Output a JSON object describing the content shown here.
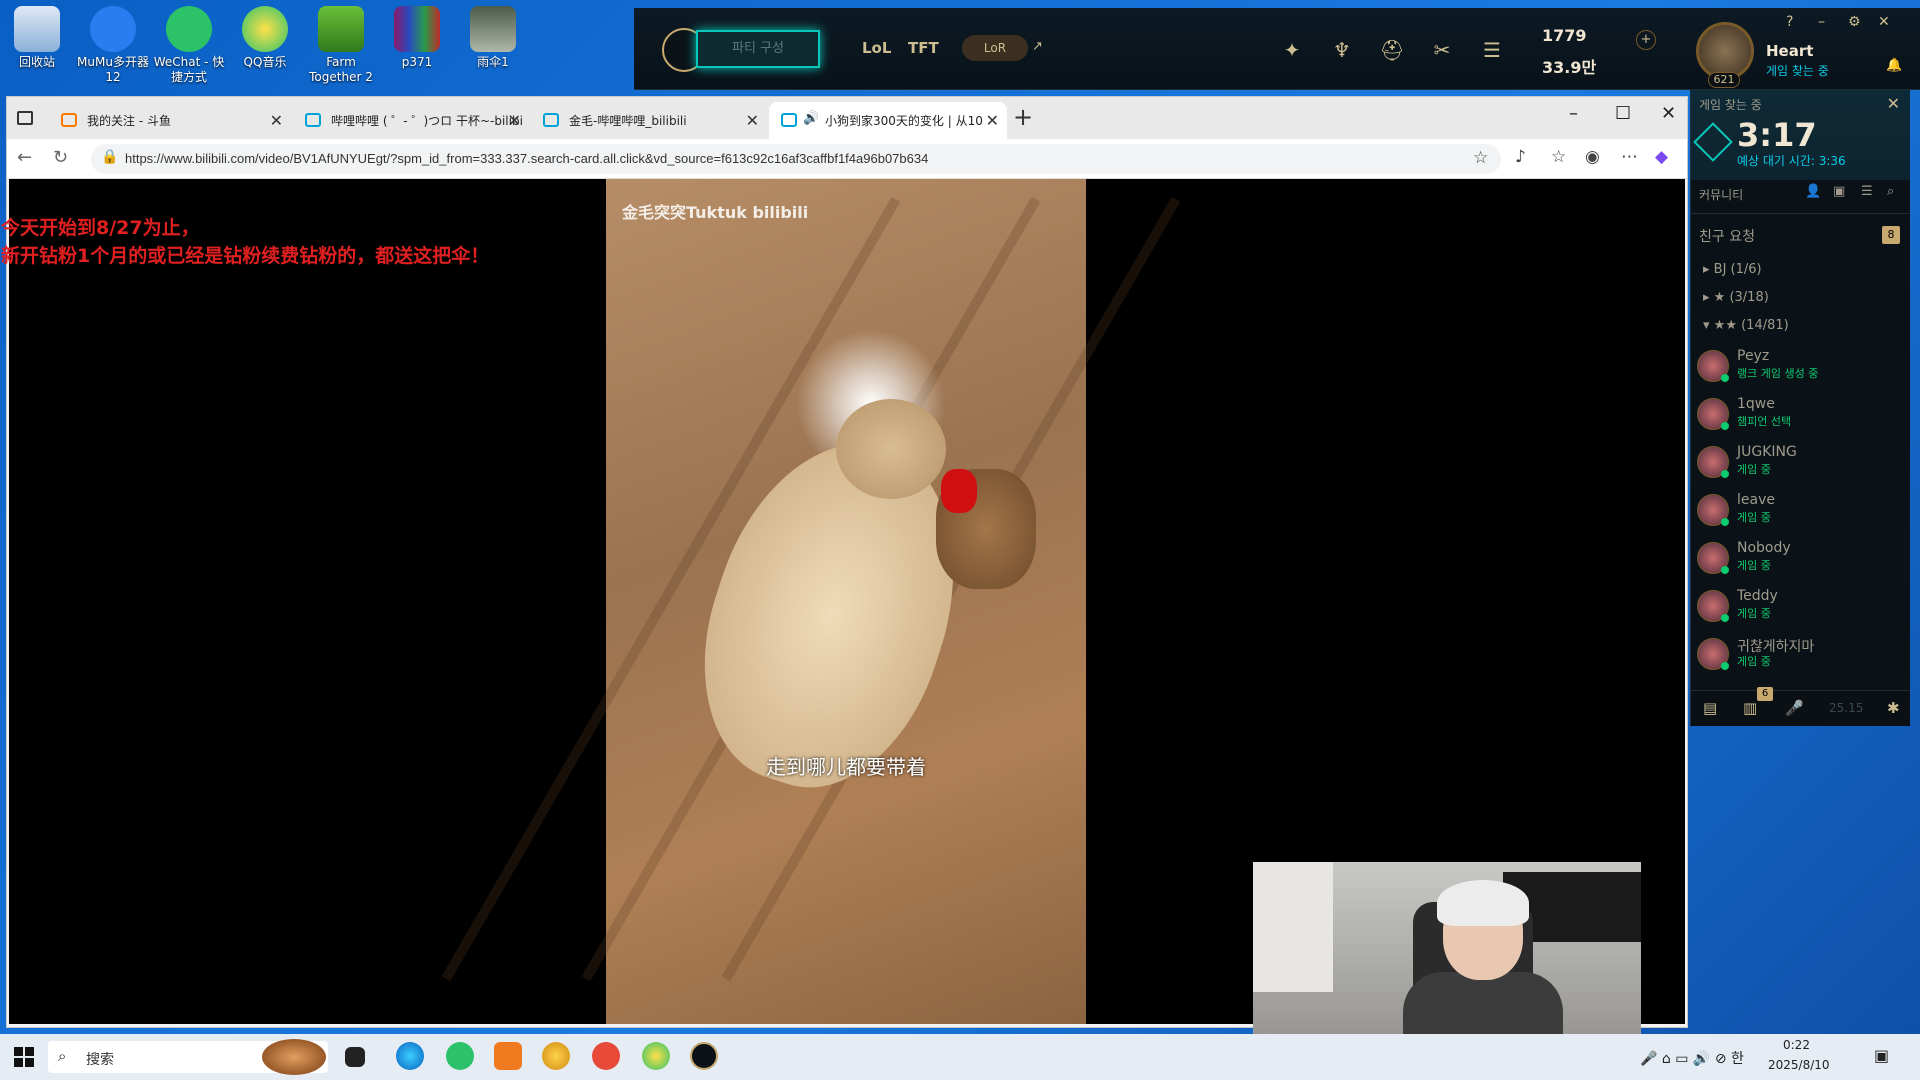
{
  "desktop_icons": [
    {
      "label": "回收站",
      "icon": "recycle-bin-icon"
    },
    {
      "label": "MuMu多开器12",
      "icon": "mumu-icon"
    },
    {
      "label": "WeChat - 快捷方式",
      "icon": "wechat-icon"
    },
    {
      "label": "QQ音乐",
      "icon": "qq-music-icon"
    },
    {
      "label": "Farm Together 2",
      "icon": "farm-together-icon"
    },
    {
      "label": "p371",
      "icon": "winrar-icon"
    },
    {
      "label": "雨伞1",
      "icon": "image-file-icon"
    }
  ],
  "league": {
    "play_button": "파티 구성",
    "nav": [
      "LoL",
      "TFT"
    ],
    "lor": "LoR",
    "lor_arrow": "↗",
    "currency": "1779",
    "rp": "33.9만",
    "summoner_name": "Heart",
    "summoner_status": "게임 찾는 중",
    "level": "621",
    "window_help": "?"
  },
  "social": {
    "queue_label": "게임 찾는 중",
    "queue_time": "3:17",
    "queue_estimate": "예상 대기 시간: 3:36",
    "community_label": "커뮤니티",
    "friend_requests_label": "친구 요청",
    "friend_requests_count": "8",
    "groups": [
      "BJ (1/6)",
      "★ (3/18)",
      "★★ (14/81)"
    ],
    "friends": [
      {
        "name": "Peyz",
        "status": "랭크 게임 생성 중"
      },
      {
        "name": "1qwe",
        "status": "챔피언 선택"
      },
      {
        "name": "JUGKING",
        "status": "게임 중"
      },
      {
        "name": "leave",
        "status": "게임 중"
      },
      {
        "name": "Nobody",
        "status": "게임 중"
      },
      {
        "name": "Teddy",
        "status": "게임 중"
      },
      {
        "name": "귀찮게하지마",
        "status": "게임 중"
      }
    ],
    "footer_badge": "6",
    "footer_time": "25.15"
  },
  "browser": {
    "tabs": [
      {
        "title": "我的关注 - 斗鱼",
        "active": false
      },
      {
        "title": "哔哩哔哩 ( ゜- ゜)つロ 干杯~-bilibi",
        "active": false
      },
      {
        "title": "金毛-哔哩哔哩_bilibili",
        "active": false
      },
      {
        "title": "小狗到家300天的变化 | 从10",
        "active": true
      }
    ],
    "url": "https://www.bilibili.com/video/BV1AfUNYUEgt/?spm_id_from=333.337.search-card.all.click&vd_source=f613c92c16af3caffbf1f4a96b07b634",
    "promo_line1": "今天开始到8/27为止，",
    "promo_line2": "新开钻粉1个月的或已经是钻粉续费钻粉的，都送这把伞！",
    "video_watermark": "金毛突突Tuktuk bilibili",
    "video_subtitle": "走到哪儿都要带着"
  },
  "taskbar": {
    "search_placeholder": "搜索",
    "time": "0:22",
    "date": "2025/8/10",
    "input_lang": "한"
  }
}
